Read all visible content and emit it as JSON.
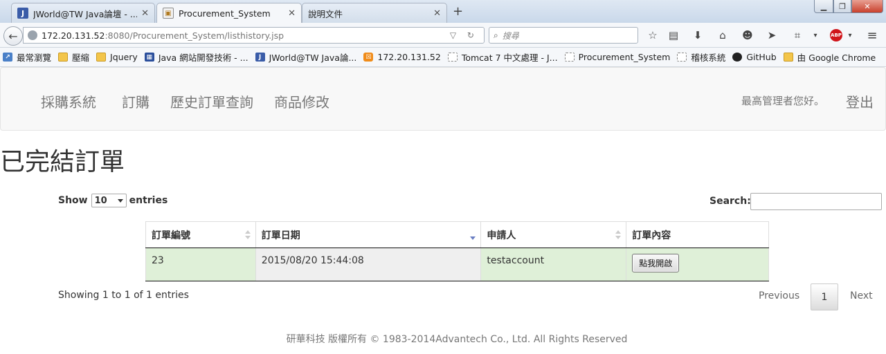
{
  "browser": {
    "tabs": [
      {
        "label": "JWorld@TW Java論壇 - ...",
        "favicon": "J"
      },
      {
        "label": "Procurement_System",
        "favicon": "pic"
      },
      {
        "label": "說明文件",
        "favicon": ""
      }
    ],
    "url_host": "172.20.131.52",
    "url_path": ":8080/Procurement_System/listhistory.jsp",
    "search_placeholder": "搜尋",
    "bookmarks": [
      "最常瀏覽",
      "壓縮",
      "Jquery",
      "Java 網站開發技術 - ...",
      "JWorld@TW Java論...",
      "172.20.131.52",
      "Tomcat 7 中文處理 - J...",
      "Procurement_System",
      "稽核系統",
      "GitHub",
      "由 Google Chrome"
    ]
  },
  "nav": {
    "brand": "採購系統",
    "links": [
      "訂購",
      "歷史訂單查詢",
      "商品修改"
    ],
    "greeting": "最高管理者您好。",
    "logout": "登出"
  },
  "page": {
    "title": "已完結訂單",
    "show_label": "Show",
    "entries_label": "entries",
    "length_value": "10",
    "search_label": "Search:"
  },
  "table": {
    "headers": [
      "訂單編號",
      "訂單日期",
      "申請人",
      "訂單內容"
    ],
    "rows": [
      {
        "id": "23",
        "date": "2015/08/20 15:44:08",
        "applicant": "testaccount",
        "button": "點我開啟"
      }
    ]
  },
  "pagination": {
    "info": "Showing 1 to 1 of 1 entries",
    "previous": "Previous",
    "current": "1",
    "next": "Next"
  },
  "footer": "研華科技 版權所有 © 1983-2014Advantech Co., Ltd. All Rights Reserved",
  "colors": {
    "row_highlight": "#dff0d8",
    "sorted_column": "#efefef",
    "navbar_bg": "#f8f8f8"
  }
}
